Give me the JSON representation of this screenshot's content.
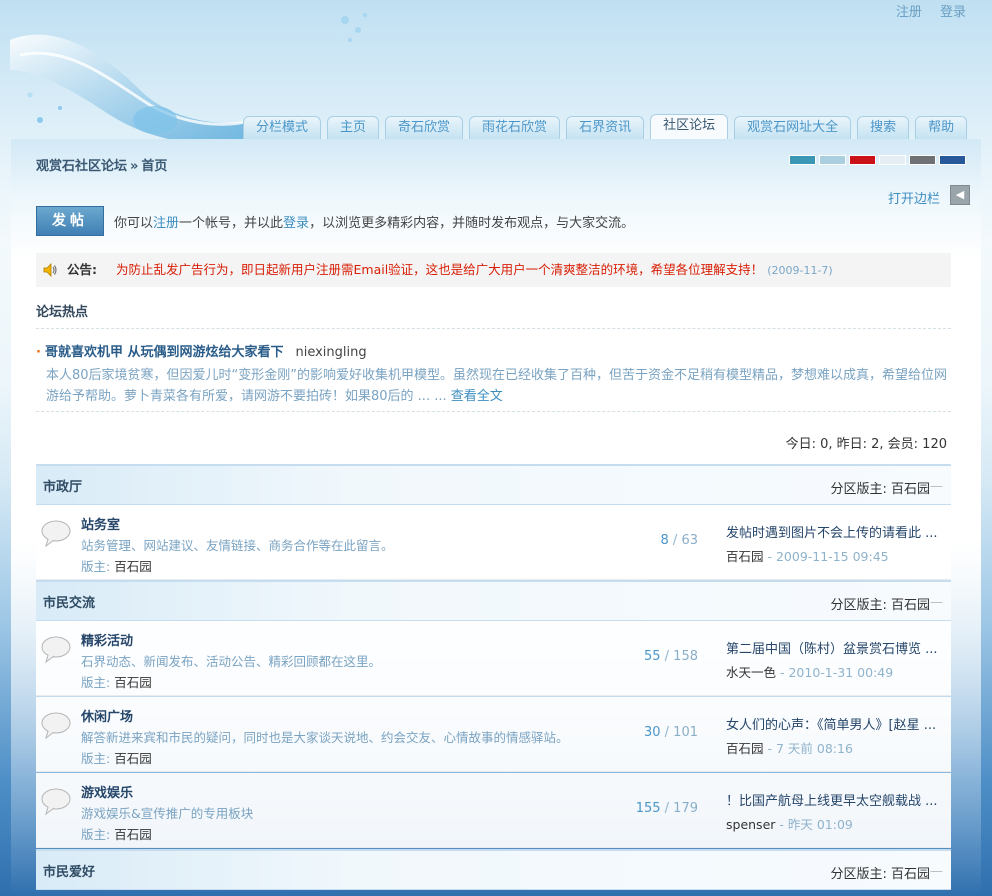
{
  "top_links": {
    "register": "注册",
    "login": "登录"
  },
  "nav": {
    "tabs": [
      {
        "label": "分栏模式",
        "active": false
      },
      {
        "label": "主页",
        "active": false
      },
      {
        "label": "奇石欣赏",
        "active": false
      },
      {
        "label": "雨花石欣赏",
        "active": false
      },
      {
        "label": "石界资讯",
        "active": false
      },
      {
        "label": "社区论坛",
        "active": true
      },
      {
        "label": "观赏石网址大全",
        "active": false
      },
      {
        "label": "搜索",
        "active": false
      },
      {
        "label": "帮助",
        "active": false
      }
    ]
  },
  "breadcrumb": {
    "site": "观赏石社区论坛",
    "sep": "»",
    "page": "首页"
  },
  "theme_colors": [
    "#3b98b4",
    "#a9cfe0",
    "#cc1219",
    "#e4eef4",
    "#6e7275",
    "#27589a"
  ],
  "sidebar": {
    "toggle_label": "打开边栏"
  },
  "post_button": {
    "label": "发帖"
  },
  "welcome": {
    "pre": "你可以",
    "register_link": "注册",
    "mid": "一个帐号，并以此",
    "login_link": "登录",
    "post": "，以浏览更多精彩内容，并随时发布观点，与大家交流。"
  },
  "notice": {
    "label": "公告:",
    "text": "为防止乱发广告行为，即日起新用户注册需Email验证，这也是给广大用户一个清爽整洁的环境，希望各位理解支持！",
    "date": "(2009-11-7)"
  },
  "hot": {
    "heading": "论坛热点",
    "item": {
      "title": "哥就喜欢机甲 从玩偶到网游炫给大家看下",
      "author": "niexingling",
      "body": "本人80后家境贫寒，但因爱儿时“变形金刚”的影响爱好收集机甲模型。虽然现在已经收集了百种，但苦于资金不足稍有模型精品，梦想难以成真，希望给位网游给予帮助。萝卜青菜各有所爱，请网游不要拍砖！如果80后的 ... ...",
      "more": "查看全文"
    }
  },
  "stats": "今日: 0, 昨日: 2, 会员: 120",
  "categories": [
    {
      "name": "市政厅",
      "mod_label": "分区版主:",
      "mod_user": "百石园",
      "forums": [
        {
          "name": "站务室",
          "desc": "站务管理、网站建议、友情链接、商务合作等在此留言。",
          "mod_label": "版主:",
          "mod_user": "百石园",
          "topics": "8",
          "posts": "63",
          "last_title": "发帖时遇到图片不会上传的请看此 ...",
          "last_user": "百石园",
          "last_time": "- 2009-11-15 09:45"
        }
      ]
    },
    {
      "name": "市民交流",
      "mod_label": "分区版主:",
      "mod_user": "百石园",
      "forums": [
        {
          "name": "精彩活动",
          "desc": "石界动态、新闻发布、活动公告、精彩回顾都在这里。",
          "mod_label": "版主:",
          "mod_user": "百石园",
          "topics": "55",
          "posts": "158",
          "last_title": "第二届中国（陈村）盆景赏石博览 ...",
          "last_user": "水天一色",
          "last_time": "- 2010-1-31 00:49"
        },
        {
          "name": "休闲广场",
          "desc": "解答新进来宾和市民的疑问，同时也是大家谈天说地、约会交友、心情故事的情感驿站。",
          "mod_label": "版主:",
          "mod_user": "百石园",
          "topics": "30",
          "posts": "101",
          "last_title": "女人们的心声：《简单男人》[赵星 ...",
          "last_user": "百石园",
          "last_time": "- 7 天前 08:16"
        },
        {
          "name": "游戏娱乐",
          "desc": "游戏娱乐&宣传推广的专用板块",
          "mod_label": "版主:",
          "mod_user": "百石园",
          "topics": "155",
          "posts": "179",
          "last_title": "！比国产航母上线更早太空舰载战 ...",
          "last_user": "spenser",
          "last_time": "- 昨天 01:09"
        }
      ]
    },
    {
      "name": "市民爱好",
      "mod_label": "分区版主:",
      "mod_user": "百石园",
      "forums": []
    }
  ]
}
